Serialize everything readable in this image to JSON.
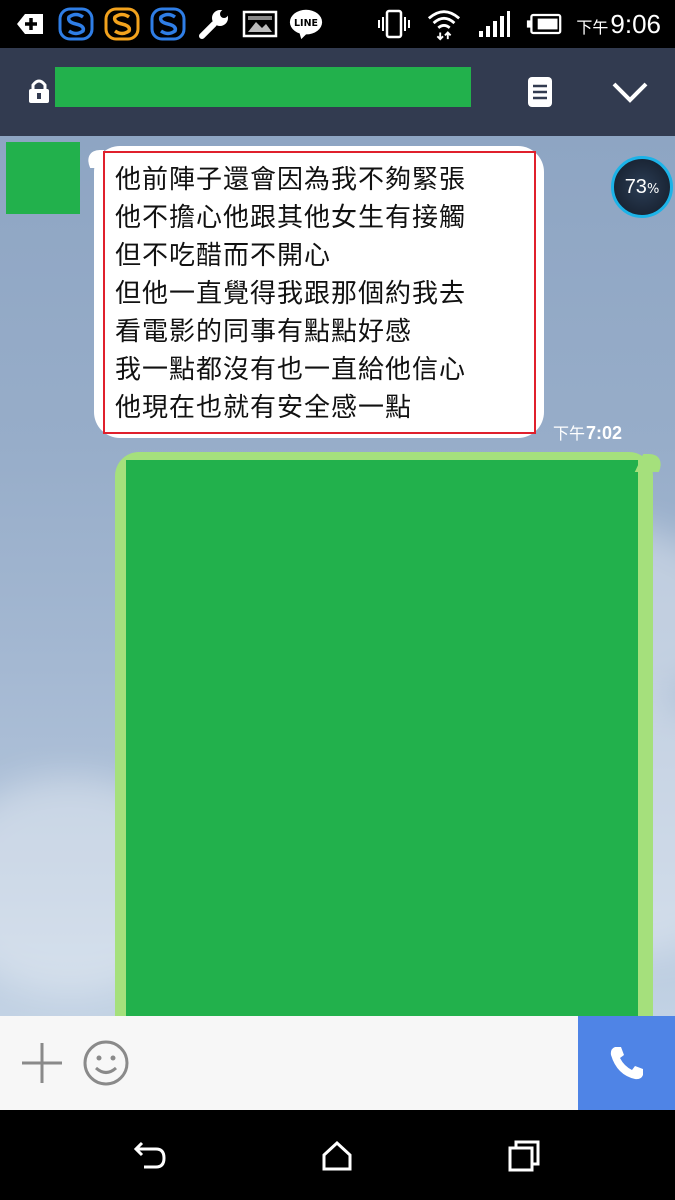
{
  "status_bar": {
    "icons_left": [
      "add-notification-icon",
      "s-app-icon-blue",
      "s-app-icon-orange",
      "s-app-icon-blue-2",
      "wrench-icon",
      "image-icon",
      "line-app-icon"
    ],
    "line_label": "LINE",
    "icons_right": [
      "vibrate-icon",
      "wifi-icon",
      "signal-icon",
      "battery-icon"
    ],
    "time_prefix": "下午",
    "time": "9:06"
  },
  "header": {
    "title": "",
    "icons": [
      "lock-icon",
      "notes-icon",
      "chevron-down-icon"
    ]
  },
  "chat": {
    "incoming_message": {
      "lines": [
        "他前陣子還會因為我不夠緊張",
        "他不擔心他跟其他女生有接觸",
        "但不吃醋而不開心",
        "但他一直覺得我跟那個約我去",
        "看電影的同事有點點好感",
        "我一點都沒有也一直給他信心",
        "他現在也就有安全感一點"
      ],
      "time_prefix": "下午",
      "time": "7:02"
    },
    "overlay_badge": {
      "value": "73",
      "unit": "%"
    },
    "colors": {
      "incoming_bubble": "#ffffff",
      "outgoing_bubble": "#a5e07c",
      "redaction": "#22b14c",
      "highlight_border": "#e0202c"
    }
  },
  "input_bar": {
    "icons": [
      "plus-icon",
      "emoji-icon",
      "phone-icon"
    ],
    "call_color": "#4f84e6"
  },
  "nav_bar": {
    "icons": [
      "back-icon",
      "home-icon",
      "recents-icon"
    ]
  }
}
